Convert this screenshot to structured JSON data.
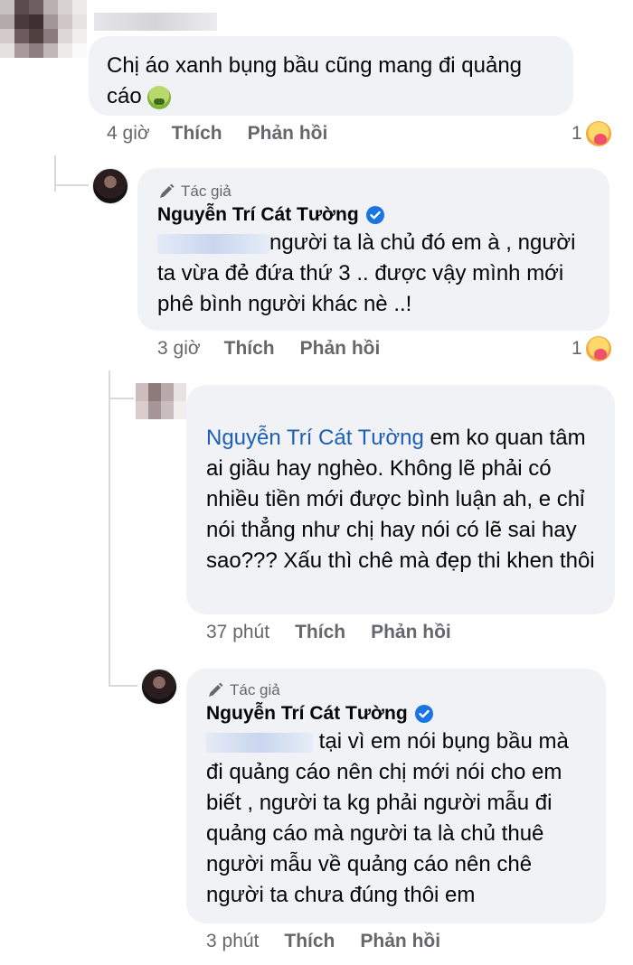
{
  "comment1": {
    "text": "Chị áo xanh bụng bầu cũng mang đi quảng cáo",
    "emoji": "nauseated-face-emoji",
    "time": "4 giờ",
    "like": "Thích",
    "reply": "Phản hồi",
    "reaction_count": "1",
    "reaction_icon": "care-emoji"
  },
  "reply1": {
    "author_tag": "Tác giả",
    "author_name": "Nguyễn Trí Cát Tường",
    "text": "người ta là chủ đó em à , người ta vừa đẻ đứa thứ 3 .. được vậy mình mới phê bình người khác nè ..!",
    "time": "3 giờ",
    "like": "Thích",
    "reply": "Phản hồi",
    "reaction_count": "1",
    "reaction_icon": "care-emoji"
  },
  "reply2": {
    "mention": "Nguyễn Trí Cát Tường",
    "text": "em ko quan tâm ai giầu hay nghèo. Không lẽ phải có nhiều tiền mới được bình luận ah, e chỉ nói thẳng như chị hay nói có lẽ sai hay sao??? Xấu thì chê mà đẹp thi khen thôi",
    "time": "37 phút",
    "like": "Thích",
    "reply": "Phản hồi"
  },
  "reply3": {
    "author_tag": "Tác giả",
    "author_name": "Nguyễn Trí Cát Tường",
    "text": "tại vì em nói bụng bầu mà đi quảng cáo nên chị mới nói cho em biết , người ta kg phải người mẫu đi quảng cáo mà người ta là chủ thuê người mẫu về quảng cáo nên chê người ta chưa đúng thôi em",
    "time": "3 phút",
    "like": "Thích",
    "reply": "Phản hồi"
  },
  "colors": {
    "bubble": "#f0f2f5",
    "secondary_text": "#65676b",
    "mention": "#1d5fb8",
    "verified": "#1b74e4"
  }
}
